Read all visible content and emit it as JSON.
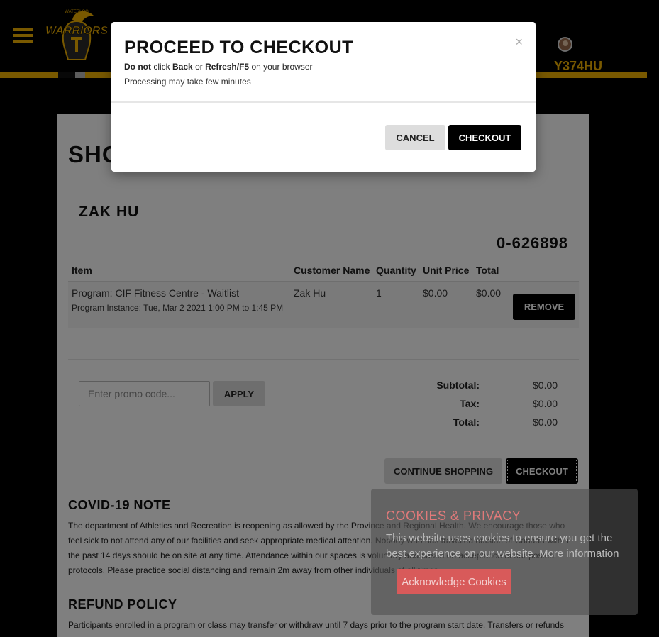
{
  "header": {
    "logo_text": "WARRIORS",
    "logo_subtext": "WATERLOO",
    "username": "Y374HU"
  },
  "cart": {
    "title": "SHOPPING CART",
    "customer_name": "ZAK HU",
    "order_number": "0-626898",
    "columns": [
      "Item",
      "Customer Name",
      "Quantity",
      "Unit Price",
      "Total"
    ],
    "items": [
      {
        "program": "Program: CIF Fitness Centre - Waitlist",
        "instance": "Program Instance: Tue, Mar 2 2021 1:00 PM to 1:45 PM",
        "customer": "Zak Hu",
        "quantity": "1",
        "unit_price": "$0.00",
        "total": "$0.00",
        "remove_label": "REMOVE"
      }
    ],
    "promo_placeholder": "Enter promo code...",
    "apply_label": "APPLY",
    "subtotal_label": "Subtotal:",
    "subtotal_value": "$0.00",
    "tax_label": "Tax:",
    "tax_value": "$0.00",
    "total_label": "Total:",
    "total_value": "$0.00",
    "continue_label": "CONTINUE SHOPPING",
    "checkout_label": "CHECKOUT"
  },
  "notes": {
    "covid_title": "COVID-19 NOTE",
    "covid_text": "The department of Athletics and Recreation is reopening as allowed by the Province and Regional Health. We encourage those who feel sick to not attend any of our facilities and seek appropriate medical attention. Nobody who has travelled outside of Canada within the past 14 days should be on site at any time. Attendance within our spaces is voluntary and based on acceptance of our posted protocols. Please practice social distancing and remain 2m away from other individuals at all times.",
    "refund_title": "REFUND POLICY",
    "refund_text": "Participants enrolled in a program or class may transfer or withdraw until 7 days prior to the program start date. Transfers or refunds"
  },
  "cookies": {
    "title": "COOKIES & PRIVACY",
    "text": "This website uses cookies to ensure you get the best experience on our website. More information",
    "button": "Acknowledge Cookies"
  },
  "modal": {
    "title": "PROCEED TO CHECKOUT",
    "warning_do_not": "Do not",
    "warning_click": "click",
    "warning_back": "Back",
    "warning_or": "or",
    "warning_refresh": "Refresh/F5",
    "warning_rest": "on your browser",
    "note": "Processing may take few minutes",
    "close": "×",
    "cancel_label": "CANCEL",
    "checkout_label": "CHECKOUT"
  }
}
